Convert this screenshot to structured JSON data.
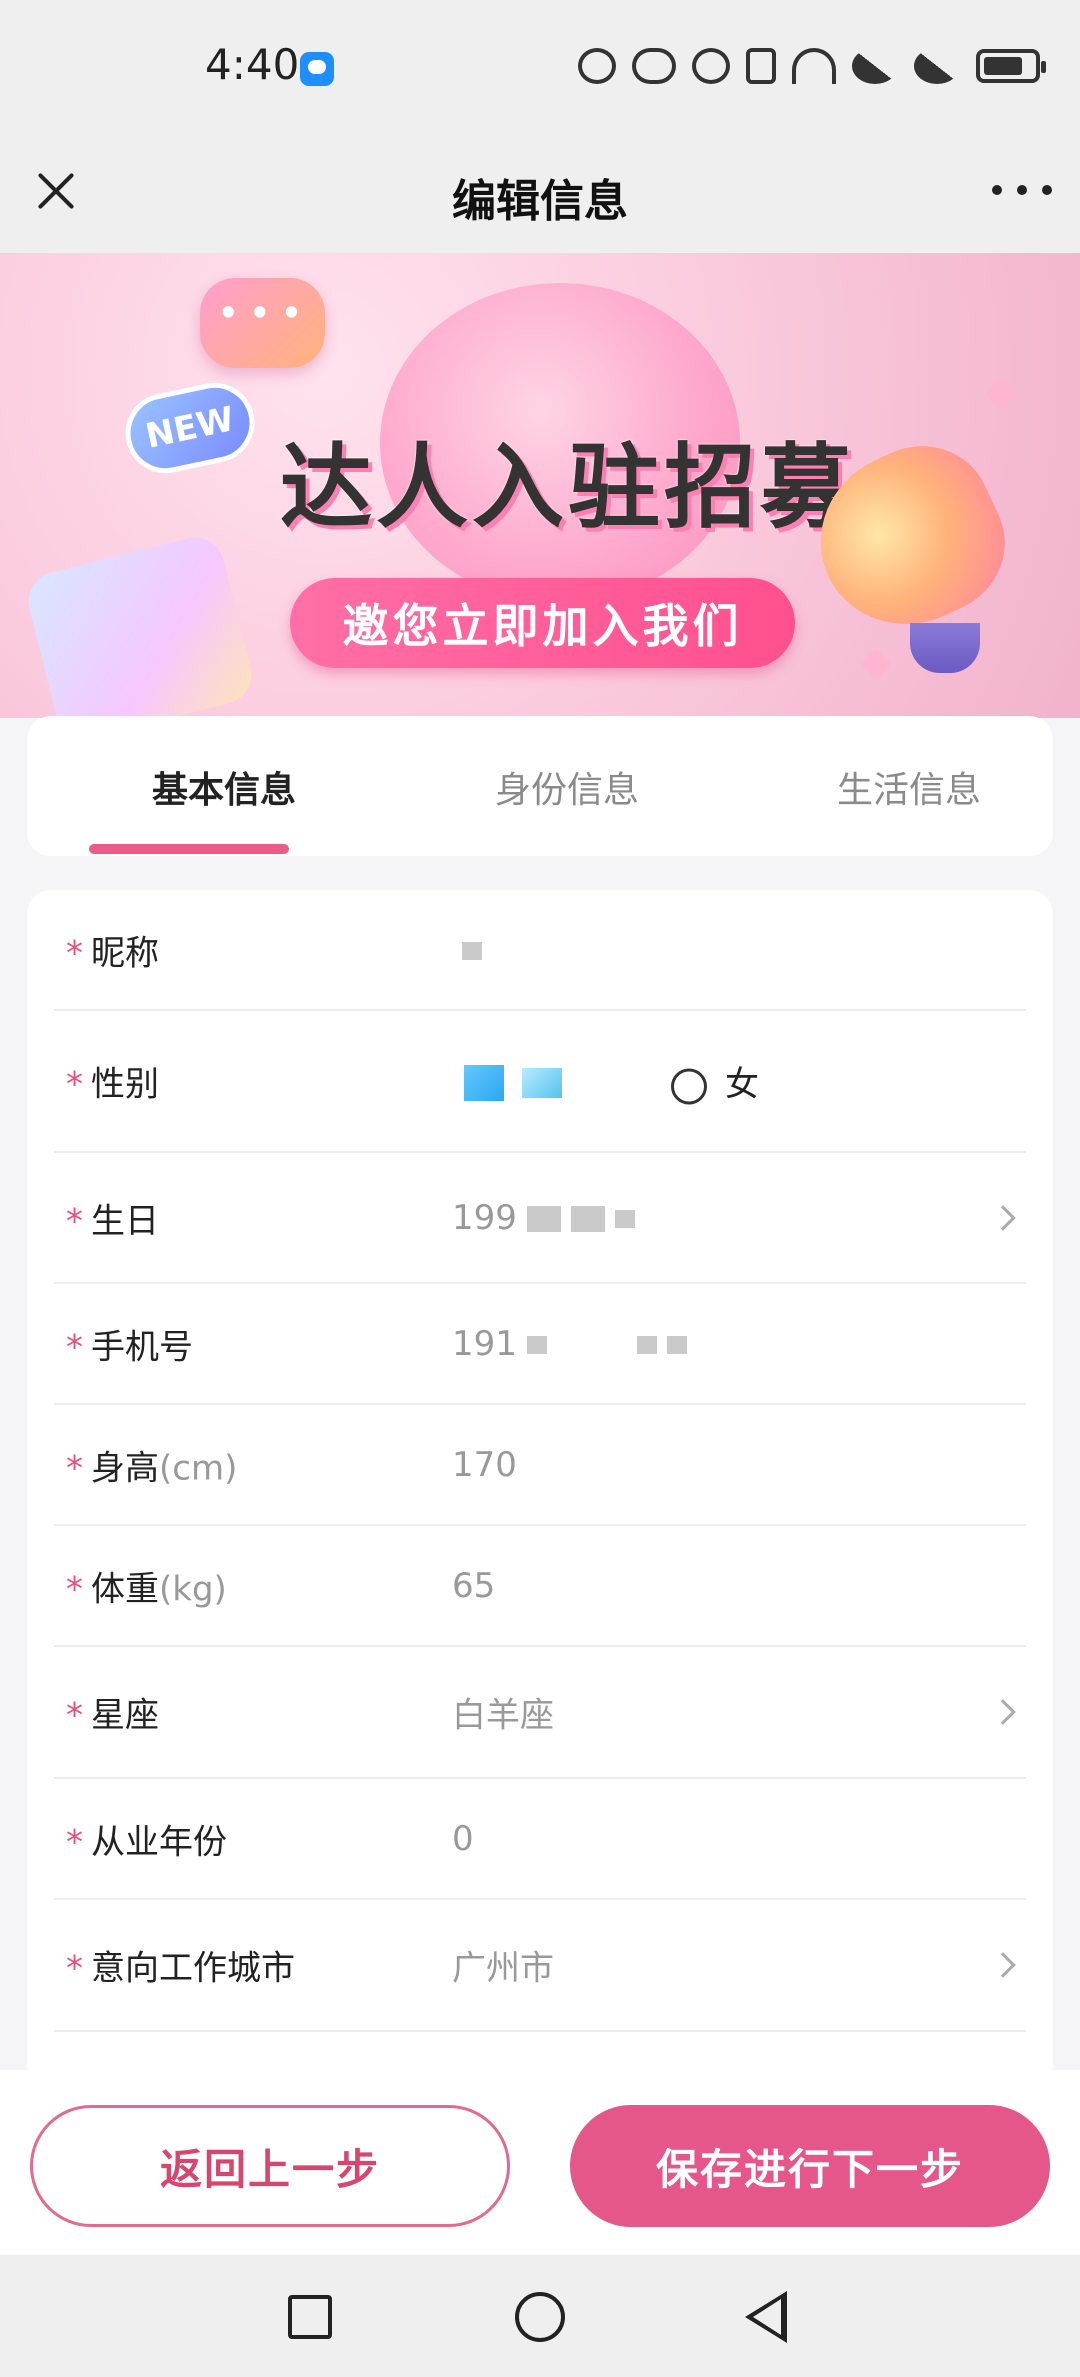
{
  "status_bar": {
    "time": "4:40",
    "icons": [
      "message-icon",
      "eye-icon",
      "alarm-icon",
      "vibrate-icon",
      "wifi-icon",
      "signal-4g-icon",
      "signal-4g-icon",
      "battery-icon"
    ]
  },
  "header": {
    "title": "编辑信息"
  },
  "banner": {
    "badge": "NEW",
    "title": "达人入驻招募",
    "cta": "邀您立即加入我们"
  },
  "tabs": [
    {
      "label": "基本信息",
      "active": true
    },
    {
      "label": "身份信息",
      "active": false
    },
    {
      "label": "生活信息",
      "active": false
    }
  ],
  "form": {
    "required_mark": "*",
    "fields": [
      {
        "label": "昵称",
        "unit": "",
        "value": ""
      },
      {
        "label": "性别",
        "unit": "",
        "value": "",
        "option_female": "女"
      },
      {
        "label": "生日",
        "unit": "",
        "value": "199"
      },
      {
        "label": "手机号",
        "unit": "",
        "value": "191"
      },
      {
        "label": "身高",
        "unit": "(cm)",
        "value": "170"
      },
      {
        "label": "体重",
        "unit": "(kg)",
        "value": "65"
      },
      {
        "label": "星座",
        "unit": "",
        "value": "白羊座"
      },
      {
        "label": "从业年份",
        "unit": "",
        "value": "0"
      },
      {
        "label": "意向工作城市",
        "unit": "",
        "value": "广州市"
      }
    ]
  },
  "actions": {
    "back": "返回上一步",
    "next": "保存进行下一步"
  },
  "colors": {
    "accent": "#e5578a",
    "required": "#e8507f"
  }
}
